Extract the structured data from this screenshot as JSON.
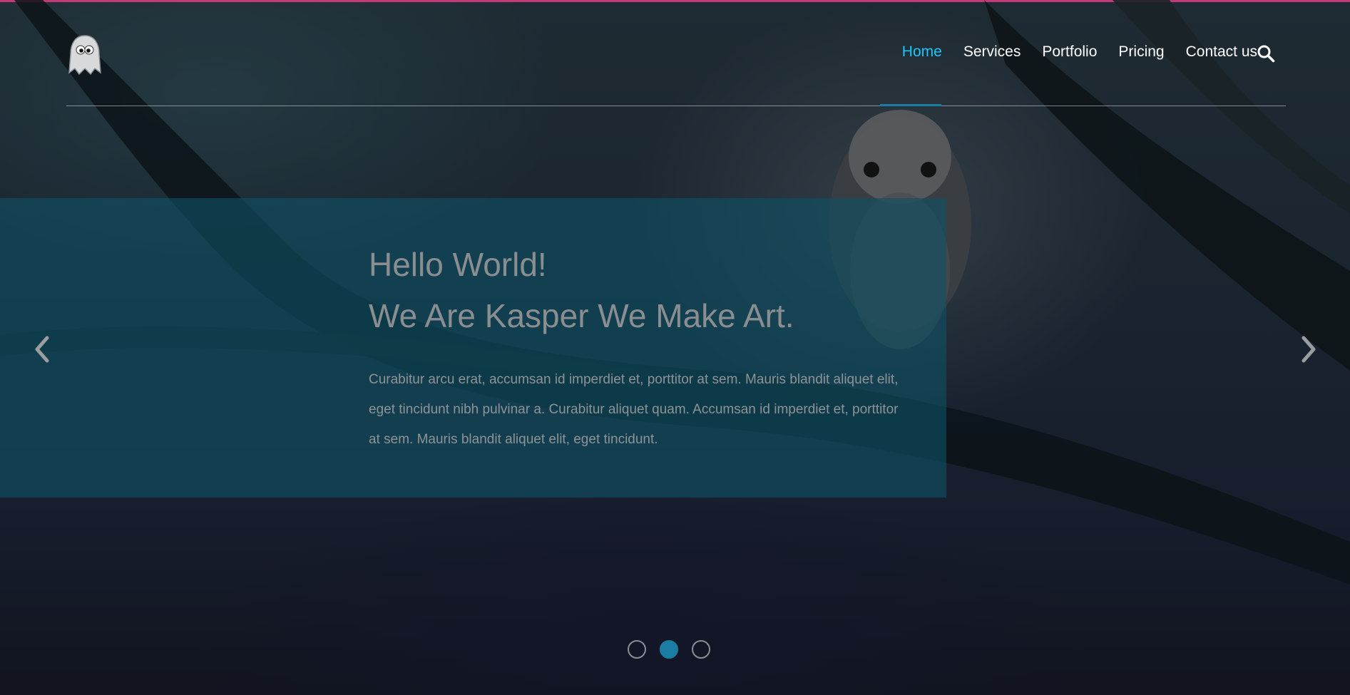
{
  "header": {
    "logo_alt": "ghost logo",
    "nav": [
      {
        "label": "Home",
        "active": true
      },
      {
        "label": "Services",
        "active": false
      },
      {
        "label": "Portfolio",
        "active": false
      },
      {
        "label": "Pricing",
        "active": false
      },
      {
        "label": "Contact us",
        "active": false
      }
    ],
    "search_icon": "search-icon"
  },
  "hero": {
    "title_line_1": "Hello World!",
    "title_line_2": "We Are Kasper We Make Art.",
    "description": "Curabitur arcu erat, accumsan id imperdiet et, porttitor at sem. Mauris blandit aliquet elit, eget tincidunt nibh pulvinar a. Curabitur aliquet quam. Accumsan id imperdiet et, porttitor at sem. Mauris blandit aliquet elit, eget tincidunt.",
    "prev_icon": "chevron-left-icon",
    "next_icon": "chevron-right-icon",
    "slides": 3,
    "active_slide": 2
  },
  "colors": {
    "accent": "#19c8fa",
    "active_bullet": "#1a7da3",
    "top_border": "#c43a78",
    "overlay": "#0e5064"
  }
}
